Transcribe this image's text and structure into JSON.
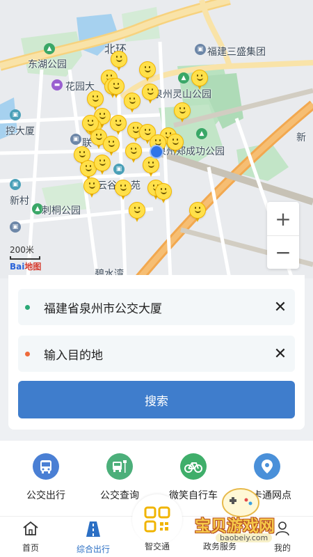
{
  "map": {
    "labels": {
      "beihuan": "北环",
      "sansheng": "福建三盛集团",
      "donghu": "东湖公园",
      "huayuan": "花园大",
      "lingshan": "泉州灵山公园",
      "kongda": "控大厦",
      "chenggong": "泉州郑成功公园",
      "xin": "新",
      "xincun": "新村",
      "citong": "刺桐公园",
      "yun_gu": "云谷",
      "yuan": "苑",
      "lian": "联",
      "bishuiwan": "碧水湾"
    },
    "scale_label": "200米",
    "logo_text": "Bai",
    "logo_suffix": "地图",
    "zoom_in": "+",
    "zoom_out": "−"
  },
  "search": {
    "origin": "福建省泉州市公交大厦",
    "destination_placeholder": "输入目的地",
    "clear_icon": "✕",
    "button_label": "搜索",
    "origin_dot_color": "#2aa876",
    "destination_dot_color": "#ee6b3c"
  },
  "quick_actions": [
    {
      "label": "公交出行",
      "icon": "bus-icon",
      "color": "#4a7fd4"
    },
    {
      "label": "公交查询",
      "icon": "bus-stop-icon",
      "color": "#4caf7a"
    },
    {
      "label": "微笑自行车",
      "icon": "bicycle-icon",
      "color": "#3fae6a"
    },
    {
      "label": "一卡通网点",
      "icon": "location-pin-icon",
      "color": "#4a90d9"
    }
  ],
  "nav": {
    "home": "首页",
    "transit": "综合出行",
    "center": "智交通",
    "gov": "政务服务",
    "mine": "我的"
  },
  "watermark": {
    "text": "宝贝游戏网",
    "url": "baobeiy.com"
  }
}
